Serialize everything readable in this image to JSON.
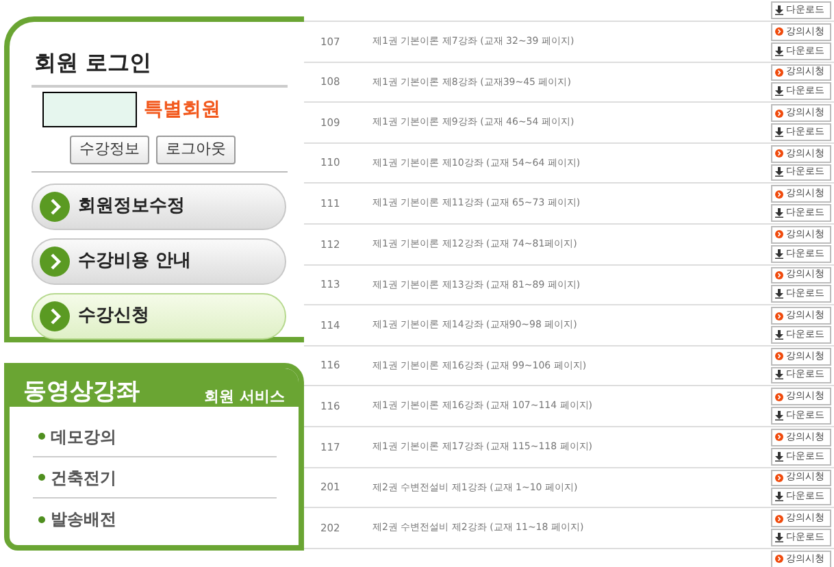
{
  "login": {
    "title": "회원 로그인",
    "member_grade": "특별회원",
    "buttons": [
      "수강정보",
      "로그아웃"
    ],
    "menu": [
      {
        "label": "회원정보수정",
        "selected": false
      },
      {
        "label": "수강비용 안내",
        "selected": false
      },
      {
        "label": "수강신청",
        "selected": true
      }
    ]
  },
  "video_panel": {
    "title": "동영상강좌",
    "subtitle": "회원 서비스",
    "items": [
      "데모강의",
      "건축전기",
      "발송배전"
    ]
  },
  "lectures": [
    {
      "download": "다운로드"
    },
    {
      "no": "107",
      "title": "제1권 기본이론 제7강좌 (교재 32~39 페이지)",
      "watch": "강의시청",
      "download": "다운로드"
    },
    {
      "no": "108",
      "title": "제1권 기본이론 제8강좌 (교재39~45 페이지)",
      "watch": "강의시청",
      "download": "다운로드"
    },
    {
      "no": "109",
      "title": "제1권 기본이론 제9강좌 (교재 46~54 페이지)",
      "watch": "강의시청",
      "download": "다운로드"
    },
    {
      "no": "110",
      "title": "제1권 기본이론 제10강좌 (교재 54~64 페이지)",
      "watch": "강의시청",
      "download": "다운로드"
    },
    {
      "no": "111",
      "title": "제1권 기본이론 제11강좌 (교재 65~73 페이지)",
      "watch": "강의시청",
      "download": "다운로드"
    },
    {
      "no": "112",
      "title": "제1권 기본이론 제12강좌 (교재 74~81페이지)",
      "watch": "강의시청",
      "download": "다운로드"
    },
    {
      "no": "113",
      "title": "제1권 기본이론 제13강좌 (교재 81~89 페이지)",
      "watch": "강의시청",
      "download": "다운로드"
    },
    {
      "no": "114",
      "title": "제1권 기본이론 제14강좌 (교재90~98 페이지)",
      "watch": "강의시청",
      "download": "다운로드"
    },
    {
      "no": "116",
      "title": "제1권 기본이론 제16강좌 (교재 99~106 페이지)",
      "watch": "강의시청",
      "download": "다운로드"
    },
    {
      "no": "116",
      "title": "제1권 기본이론 제16강좌 (교재 107~114 페이지)",
      "watch": "강의시청",
      "download": "다운로드"
    },
    {
      "no": "117",
      "title": "제1권 기본이론 제17강좌 (교재 115~118 페이지)",
      "watch": "강의시청",
      "download": "다운로드"
    },
    {
      "no": "201",
      "title": "제2권 수변전설비 제1강좌 (교재 1~10 페이지)",
      "watch": "강의시청",
      "download": "다운로드"
    },
    {
      "no": "202",
      "title": "제2권 수변전설비 제2강좌 (교재 11~18 페이지)",
      "watch": "강의시청",
      "download": "다운로드"
    },
    {
      "watch": "강의시청"
    }
  ]
}
